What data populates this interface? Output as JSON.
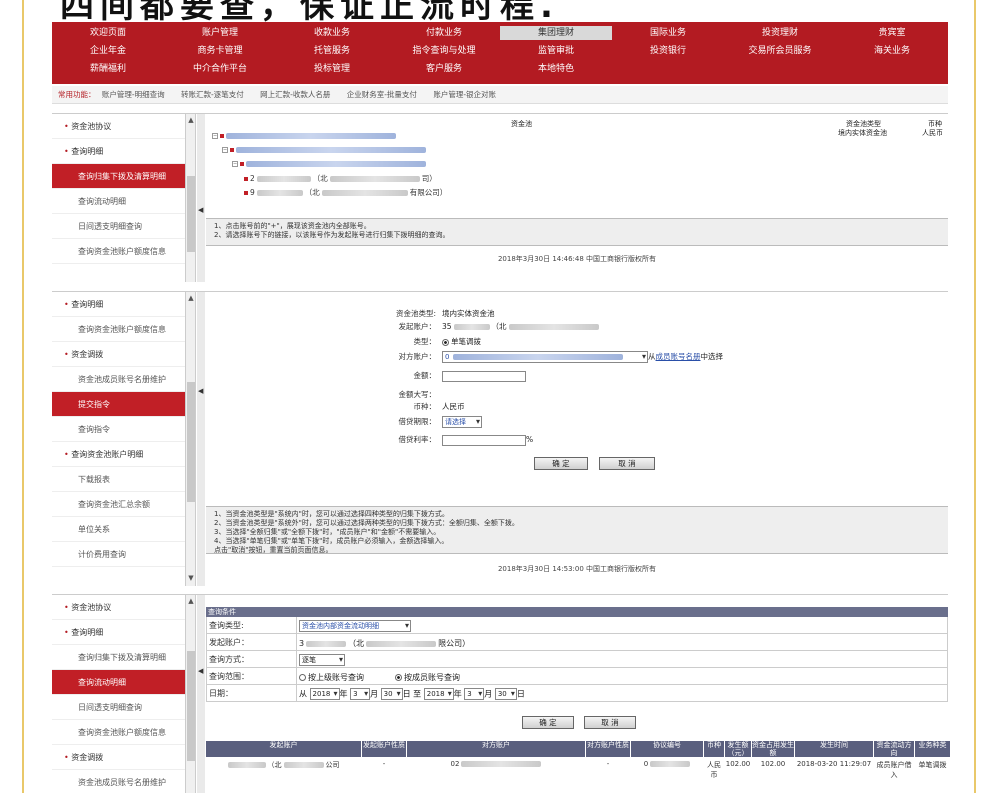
{
  "title_strip": "四间都要查，保证正流时程.",
  "topnav": {
    "row1": [
      "欢迎页面",
      "账户管理",
      "收款业务",
      "付款业务",
      "集团理财",
      "国际业务",
      "投资理财",
      "贵宾室"
    ],
    "row2": [
      "企业年金",
      "商务卡管理",
      "托管服务",
      "指令查询与处理",
      "监管审批",
      "投资银行",
      "交易所会员服务",
      "海关业务"
    ],
    "row3": [
      "薪酬福利",
      "中介合作平台",
      "投标管理",
      "客户服务",
      "本地特色"
    ]
  },
  "quickbar": {
    "label": "常用功能：",
    "links": [
      "账户管理-明细查询",
      "转账汇款-逐笔支付",
      "网上汇款-收款人名册",
      "企业财务室-批量支付",
      "账户管理-银企对账"
    ]
  },
  "panel1": {
    "sidebar": [
      "资金池协议",
      "查询明细",
      "查询归集下拨及清算明细",
      "查询流动明细",
      "日间透支明细查询",
      "查询资金池账户额度信息"
    ],
    "header": {
      "pool_label": "资金池",
      "type_label": "资金池类型",
      "type_value": "境内实体资金池",
      "currency_label": "币种",
      "currency_value": "人民币"
    },
    "tree_suffix_1": "（北",
    "tree_suffix_2": "有限公司）",
    "tree_suffix_3": "司）",
    "notes": [
      "1、点击账号前的\"+\"，展现该资金池内全部账号。",
      "2、请选择账号下的链接，以该账号作为发起账号进行归集下拨明细的查询。"
    ],
    "footer": "2018年3月30日 14:46:48   中国工商银行版权所有"
  },
  "panel2": {
    "sidebar": [
      "查询明细",
      "查询资金池账户额度信息",
      "资金调拨",
      "资金池成员账号名册维护",
      "提交指令",
      "查询指令",
      "查询资金池账户明细",
      "下载报表",
      "查询资金池汇总余额",
      "单位关系",
      "计价费用查询"
    ],
    "form": {
      "pool_type_label": "资金池类型:",
      "pool_type_value": "境内实体资金池",
      "from_account_label": "发起账户：",
      "from_account_value": "35",
      "from_account_suffix": "（北",
      "type_label": "类型：",
      "type_option": "单笔调拨",
      "to_account_label": "对方账户：",
      "to_account_value": "0",
      "to_account_hint_pre": "从",
      "to_account_hint_link": "成员账号名册",
      "to_account_hint_post": "中选择",
      "amount_label": "金额：",
      "amount_upper_label": "金额大写：",
      "currency_label": "币种：",
      "currency_value": "人民币",
      "period_label": "借贷期限：",
      "period_value": "请选择",
      "rate_label": "借贷利率：",
      "rate_unit": "%",
      "confirm": "确 定",
      "cancel": "取 消"
    },
    "notes": [
      "1、当资金池类型是\"系统内\"时，您可以通过选择四种类型的归集下拨方式。",
      "2、当资金池类型是\"系统外\"时，您可以通过选择两种类型的归集下拨方式：全额归集、全额下拨。",
      "3、当选择\"全额归集\"或\"全额下拨\"时，\"成员账户\"和\"金额\"不需要输入。",
      "4、当选择\"单笔归集\"或\"单笔下拨\"时，成员账户必须输入，金额选择输入。",
      "点击\"取消\"按钮，重置当前页面信息。"
    ],
    "footer": "2018年3月30日 14:53:00   中国工商银行版权所有"
  },
  "panel3": {
    "sidebar": [
      "资金池协议",
      "查询明细",
      "查询归集下拨及清算明细",
      "查询流动明细",
      "日间透支明细查询",
      "查询资金池账户额度信息",
      "资金调拨",
      "资金池成员账号名册维护"
    ],
    "query": {
      "header": "查询条件",
      "type_label": "查询类型:",
      "type_value": "资金池内部资金流动明细",
      "from_label": "发起账户：",
      "from_value": "3",
      "from_suffix": "（北",
      "from_end": "限公司）",
      "method_label": "查询方式：",
      "method_value": "逐笔",
      "scope_label": "查询范围：",
      "scope_opt1": "按上级账号查询",
      "scope_opt2": "按成员账号查询",
      "date_label": "日期：",
      "date_from_word": "从",
      "year1": "2018",
      "month1": "3",
      "day1": "30",
      "date_to_word": "日 至",
      "year2": "2018",
      "month2": "3",
      "day2": "30",
      "year_word": "年",
      "month_word": "月",
      "day_word": "日",
      "confirm": "确 定",
      "cancel": "取 消"
    },
    "table": {
      "headers": [
        "发起账户",
        "发起账户性质",
        "对方账户",
        "对方账户性质",
        "协议编号",
        "币种",
        "发生额（元）",
        "资金占用发生额",
        "发生时间",
        "资金流动方向",
        "业务种类"
      ],
      "row": {
        "from": "（北",
        "from_end": "公司",
        "from_type": "-",
        "to": "02",
        "to_type": "-",
        "agreement": "0",
        "currency": "人民币",
        "amount": "102.00",
        "occupied": "102.00",
        "time": "2018-03-20 11:29:07",
        "direction": "成员账户借入",
        "biz": "单笔调拨"
      }
    }
  },
  "colors": {
    "brand": "#b31b22",
    "selected": "#c11f26",
    "frame": "#e9c86a"
  }
}
